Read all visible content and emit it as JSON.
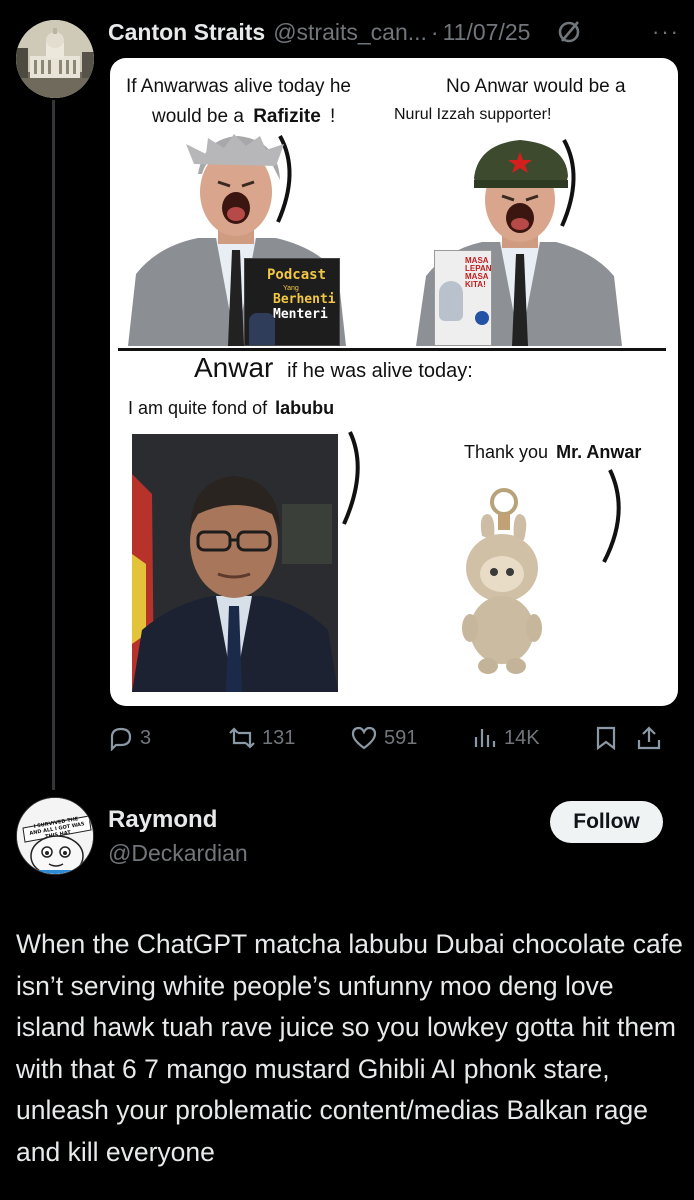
{
  "post1": {
    "author_name": "Canton Straits",
    "handle": "@straits_can...",
    "separator": "·",
    "date": "11/07/25",
    "more_label": "···",
    "avatar_icon": "building-photo-avatar",
    "meme": {
      "left_caption_line1_a": "If Anwarwas alive today he",
      "left_caption_line2_a": "would be a",
      "left_caption_line2_b": "Rafizite",
      "left_caption_line2_c": "!",
      "right_caption_line1": "No Anwar would be a",
      "right_caption_line2": "Nurul Izzah supporter!",
      "podcast_title": "Podcast",
      "podcast_sub1": "Yang",
      "podcast_sub2": "Berhenti",
      "podcast_sub3": "Menteri",
      "book_title1": "MASA",
      "book_title2": "LEPAN",
      "book_title3": "MASA",
      "book_title4": "KITA!",
      "divider_big": "Anwar",
      "divider_rest": "if he was alive today:",
      "bottom_left_caption_a": "I am quite fond of",
      "bottom_left_caption_b": "labubu",
      "bottom_right_caption_a": "Thank you",
      "bottom_right_caption_b": "Mr. Anwar"
    },
    "actions": {
      "replies": "3",
      "reposts": "131",
      "likes": "591",
      "views": "14K"
    }
  },
  "post2": {
    "author_name": "Raymond",
    "handle": "@Deckardian",
    "follow_label": "Follow",
    "avatar_icon": "cartoon-avatar",
    "avatar_text1": "I SURVIVED THE",
    "avatar_text2": "AND ALL I GOT WAS",
    "avatar_text3": "THIS HAT",
    "body": "When the ChatGPT matcha labubu Dubai chocolate cafe isn’t serving white people’s unfunny moo deng love island hawk tuah rave juice so you lowkey gotta hit them with that 6 7 mango mustard Ghibli AI phonk stare, unleash your problematic content/medias Balkan rage and kill everyone"
  },
  "colors": {
    "background": "#000000",
    "text_primary": "#e7e9ea",
    "text_secondary": "#71767b",
    "follow_bg": "#eff3f4",
    "thread_line": "#333639"
  }
}
